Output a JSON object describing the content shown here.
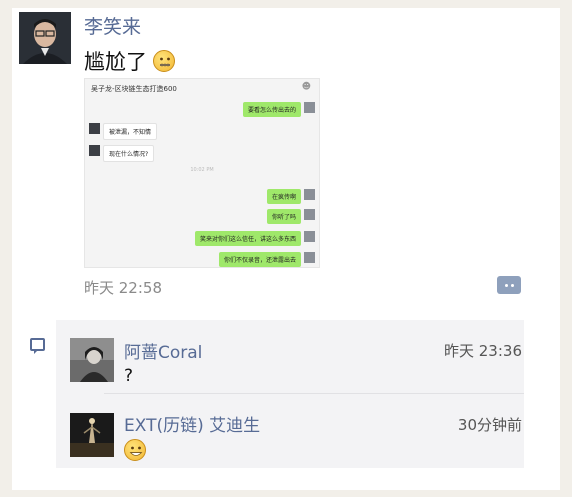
{
  "post": {
    "author": "李笑来",
    "text": "尴尬了",
    "emoji_icon": "zipper-mouth-face-icon",
    "time": "昨天 22:58",
    "more_icon": "more-dots-icon"
  },
  "screenshot": {
    "title": "吴子龙-区块链生态打造600",
    "time": "10:02 PM",
    "messages": [
      {
        "side": "me",
        "text": "要看怎么传出去的"
      },
      {
        "side": "other",
        "text": "被泄漏，不知情"
      },
      {
        "side": "other",
        "text": "现在什么情况?"
      },
      {
        "side": "me",
        "text": "在疯传啊"
      },
      {
        "side": "me",
        "text": "你听了吗"
      },
      {
        "side": "me",
        "text": "笑来对你们这么信任，讲这么多东西"
      },
      {
        "side": "me",
        "text": "你们不仅录音，还泄露出去"
      }
    ]
  },
  "comments": [
    {
      "name": "阿蔷Coral",
      "time": "昨天 23:36",
      "text": "?"
    },
    {
      "name": "EXT(历链) 艾迪生",
      "time": "30分钟前",
      "emoji_icon": "grinning-face-icon"
    }
  ]
}
